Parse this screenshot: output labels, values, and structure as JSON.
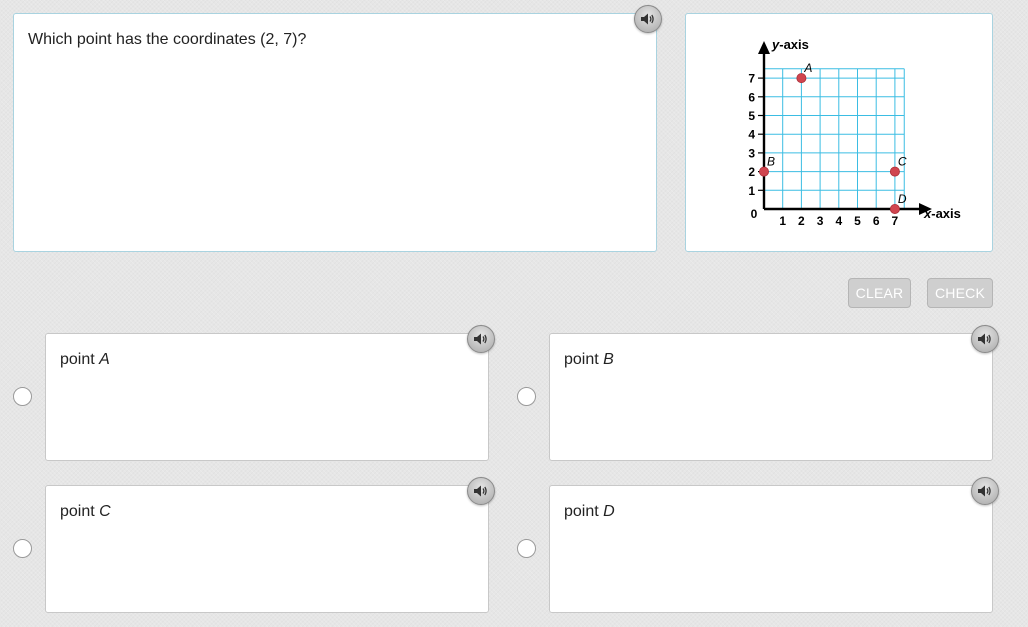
{
  "question": {
    "text": "Which point has the coordinates (2, 7)?"
  },
  "graph": {
    "y_axis_label": "y-axis",
    "x_axis_label": "x-axis",
    "origin_label": "0",
    "x_ticks": [
      "1",
      "2",
      "3",
      "4",
      "5",
      "6",
      "7"
    ],
    "y_ticks": [
      "1",
      "2",
      "3",
      "4",
      "5",
      "6",
      "7"
    ],
    "grid_color": "#3bbde3",
    "point_color": "#d0454f",
    "points": [
      {
        "label": "A",
        "x": 2,
        "y": 7
      },
      {
        "label": "B",
        "x": 0,
        "y": 2
      },
      {
        "label": "C",
        "x": 7,
        "y": 2
      },
      {
        "label": "D",
        "x": 7,
        "y": 0
      }
    ]
  },
  "buttons": {
    "clear": "CLEAR",
    "check": "CHECK"
  },
  "options": [
    {
      "prefix": "point",
      "letter": "A"
    },
    {
      "prefix": "point",
      "letter": "B"
    },
    {
      "prefix": "point",
      "letter": "C"
    },
    {
      "prefix": "point",
      "letter": "D"
    }
  ],
  "icons": {
    "speaker": "speaker-icon"
  }
}
